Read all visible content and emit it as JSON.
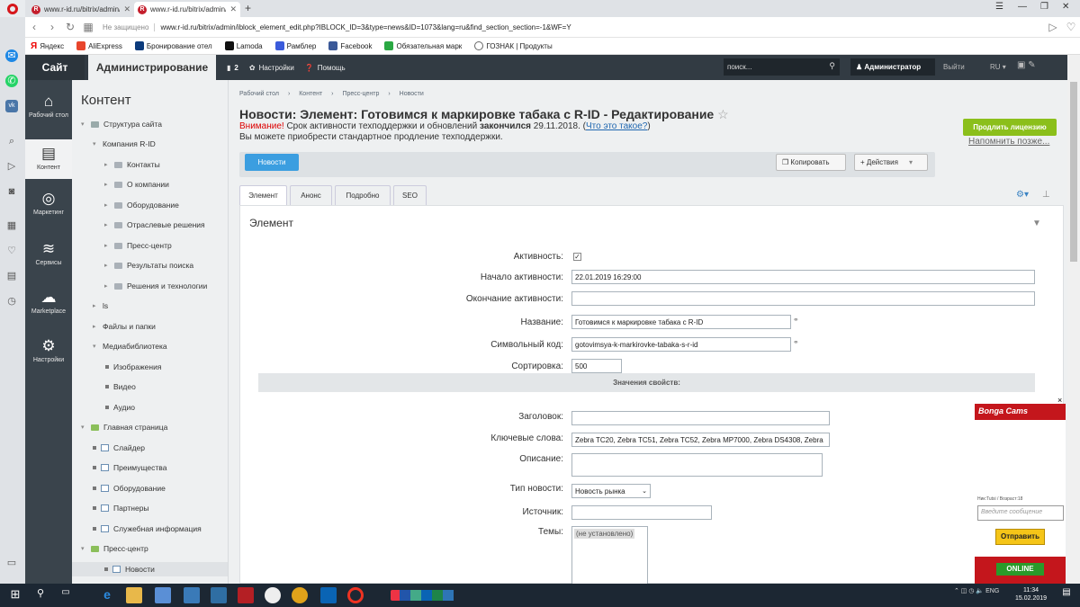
{
  "browser": {
    "tabs": [
      {
        "title": "www.r-id.ru/bitrix/admin/i"
      },
      {
        "title": "www.r-id.ru/bitrix/admin/i"
      }
    ],
    "new_tab": "+",
    "security": "Не защищено",
    "url": "www.r-id.ru/bitrix/admin/iblock_element_edit.php?IBLOCK_ID=3&type=news&ID=1073&lang=ru&find_section_section=-1&WF=Y",
    "bookmarks": [
      "Яндекс",
      "AliExpress",
      "Бронирование отел",
      "Lamoda",
      "Рамблер",
      "Facebook",
      "Обязательная марк",
      "ГОЗНАК | Продукты"
    ]
  },
  "adminbar": {
    "site": "Сайт",
    "admin": "Администрирование",
    "notif_count": "2",
    "settings": "Настройки",
    "help": "Помощь",
    "search_placeholder": "поиск...",
    "user": "Администратор",
    "logout": "Выйти",
    "lang": "RU"
  },
  "leftnav": [
    {
      "label": "Рабочий стол"
    },
    {
      "label": "Контент"
    },
    {
      "label": "Маркетинг"
    },
    {
      "label": "Сервисы"
    },
    {
      "label": "Marketplace"
    },
    {
      "label": "Настройки"
    }
  ],
  "tree": {
    "title": "Контент",
    "items": [
      "Структура сайта",
      "Компания R-ID",
      "Контакты",
      "О компании",
      "Оборудование",
      "Отраслевые решения",
      "Пресс-центр",
      "Результаты поиска",
      "Решения и технологии",
      "ls",
      "Файлы и папки",
      "Медиабиблиотека",
      "Изображения",
      "Видео",
      "Аудио",
      "Главная страница",
      "Слайдер",
      "Преимущества",
      "Оборудование",
      "Партнеры",
      "Служебная информация",
      "Пресс-центр",
      "Новости"
    ]
  },
  "main": {
    "breadcrumb": [
      "Рабочий стол",
      "Контент",
      "Пресс-центр",
      "Новости"
    ],
    "title": "Новости: Элемент: Готовимся к маркировке табака с R-ID - Редактирование",
    "warn_attention": "Внимание!",
    "warn_text": " Срок активности техподдержки и обновлений ",
    "warn_bold": "закончился",
    "warn_date": " 29.11.2018. (",
    "warn_link": "Что это такое?",
    "warn_close": ")",
    "warn_line2": "Вы можете приобрести стандартное продление техподдержки.",
    "btn_license": "Продлить лицензию",
    "remind": "Напомнить позже...",
    "btn_news": "Новости",
    "btn_copy": "Копировать",
    "btn_actions": "Действия",
    "tabs": [
      "Элемент",
      "Анонс",
      "Подробно",
      "SEO"
    ],
    "section_title": "Элемент",
    "fields": {
      "active_label": "Активность:",
      "active_checked": true,
      "start_label": "Начало активности:",
      "start_value": "22.01.2019 16:29:00",
      "end_label": "Окончание активности:",
      "end_value": "",
      "name_label": "Название:",
      "name_value": "Готовимся к маркировке табака с R-ID",
      "code_label": "Символьный код:",
      "code_value": "gotovimsya-k-markirovke-tabaka-s-r-id",
      "sort_label": "Сортировка:",
      "sort_value": "500",
      "props_header": "Значения свойств:",
      "headline_label": "Заголовок:",
      "headline_value": "",
      "keywords_label": "Ключевые слова:",
      "keywords_value": "Zebra TC20, Zebra TC51, Zebra TC52, Zebra MP7000, Zebra DS4308, Zebra",
      "desc_label": "Описание:",
      "desc_value": "",
      "type_label": "Тип новости:",
      "type_value": "Новость рынка",
      "source_label": "Источник:",
      "source_value": "",
      "themes_label": "Темы:",
      "themes_value": "(не установлено)"
    }
  },
  "chat": {
    "brand": "Bonga Cams",
    "meta": "Ник:Tutsi / Возраст:18",
    "input_placeholder": "Введите сообщение",
    "send": "Отправить",
    "online": "ONLINE",
    "close": "×"
  },
  "taskbar": {
    "lang": "ENG",
    "time": "11:34",
    "date": "15.02.2019"
  }
}
